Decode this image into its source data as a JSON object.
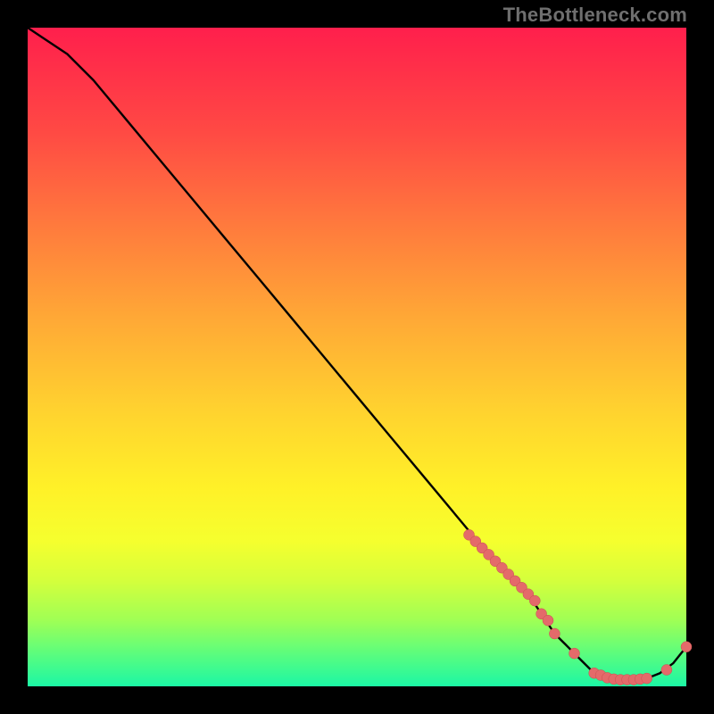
{
  "watermark": "TheBottleneck.com",
  "colors": {
    "page_bg": "#000000",
    "curve_stroke": "#000000",
    "marker_fill": "#e46a6a",
    "marker_stroke": "#c84f4f"
  },
  "chart_data": {
    "type": "line",
    "title": "",
    "xlabel": "",
    "ylabel": "",
    "xlim": [
      0,
      100
    ],
    "ylim": [
      0,
      100
    ],
    "grid": false,
    "legend": false,
    "series": [
      {
        "name": "bottleneck-curve",
        "x": [
          0,
          3,
          6,
          10,
          15,
          20,
          25,
          30,
          35,
          40,
          45,
          50,
          55,
          60,
          65,
          70,
          72,
          74,
          76,
          78,
          80,
          82,
          84,
          86,
          88,
          90,
          92,
          94,
          96,
          98,
          100
        ],
        "y": [
          100,
          98,
          96,
          92,
          86,
          80,
          74,
          68,
          62,
          56,
          50,
          44,
          38,
          32,
          26,
          20,
          18,
          16,
          14,
          11,
          8,
          6,
          4,
          2,
          1.3,
          1.0,
          1.0,
          1.2,
          2.0,
          3.5,
          6
        ]
      }
    ],
    "markers": {
      "name": "highlight-points",
      "x": [
        67,
        68,
        69,
        70,
        71,
        72,
        73,
        74,
        75,
        76,
        77,
        78,
        79,
        80,
        83,
        86,
        87,
        88,
        89,
        90,
        91,
        92,
        93,
        94,
        97,
        100
      ],
      "y": [
        23,
        22,
        21,
        20,
        19,
        18,
        17,
        16,
        15,
        14,
        13,
        11,
        10,
        8,
        5,
        2,
        1.7,
        1.3,
        1.1,
        1.0,
        1.0,
        1.0,
        1.1,
        1.2,
        2.5,
        6
      ]
    }
  }
}
